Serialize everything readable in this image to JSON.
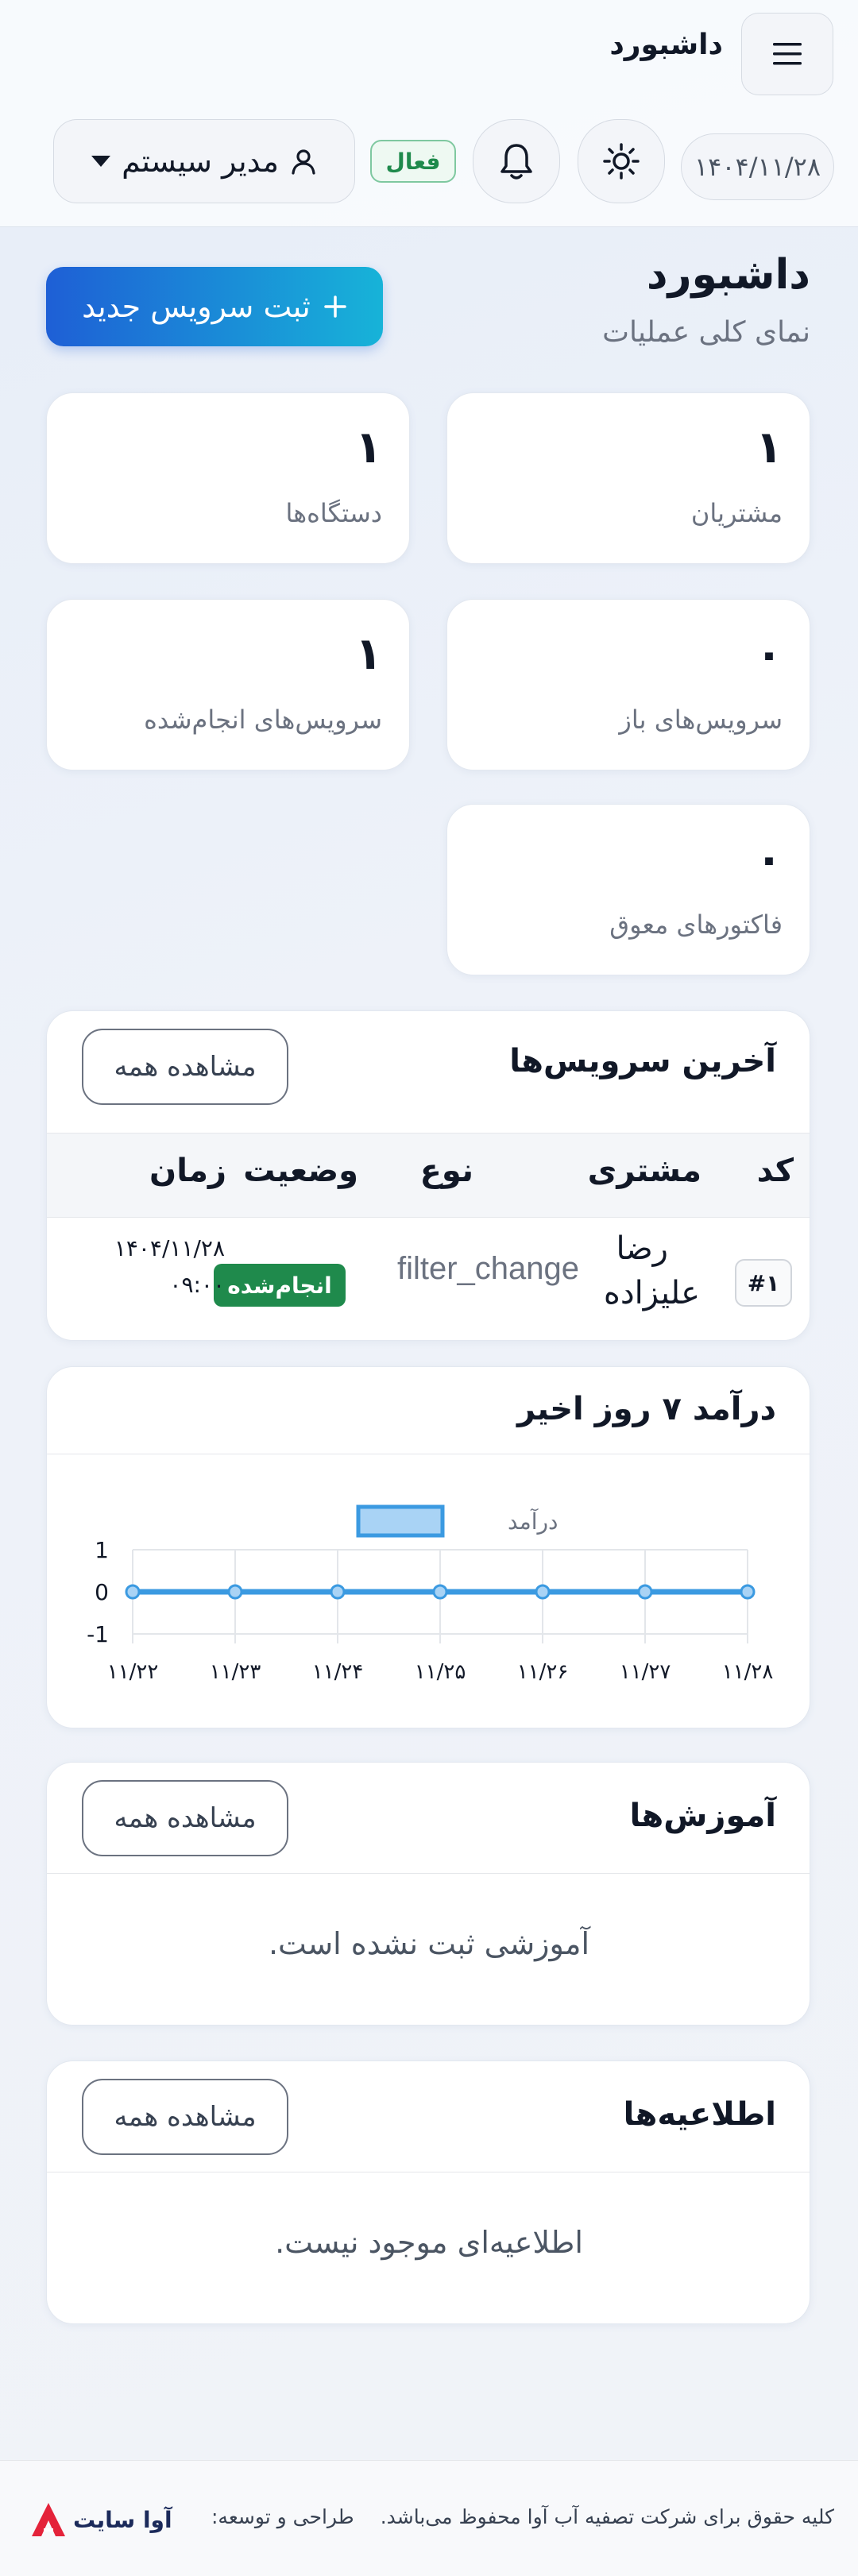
{
  "header": {
    "app_title": "داشبورد",
    "date": "۱۴۰۴/۱۱/۲۸",
    "status_badge": "فعال",
    "user_name": "مدیر سیستم",
    "icons": [
      "menu-icon",
      "sun-icon",
      "bell-icon",
      "user-icon",
      "caret-down-icon"
    ]
  },
  "page": {
    "title": "داشبورد",
    "subtitle": "نمای کلی عملیات",
    "new_service_button": "ثبت سرویس جدید"
  },
  "stats": [
    {
      "label": "مشتریان",
      "value": "۱"
    },
    {
      "label": "دستگاه‌ها",
      "value": "۱"
    },
    {
      "label": "سرویس‌های باز",
      "value": "۰"
    },
    {
      "label": "سرویس‌های انجام‌شده",
      "value": "۱"
    },
    {
      "label": "فاکتورهای معوق",
      "value": "۰"
    }
  ],
  "recent_services": {
    "title": "آخرین سرویس‌ها",
    "view_all": "مشاهده همه",
    "columns": [
      "کد",
      "مشتری",
      "نوع",
      "وضعیت",
      "زمان"
    ],
    "rows": [
      {
        "id": "#۱",
        "customer_line1": "رضا",
        "customer_line2": "علیزاده",
        "type": "filter_change",
        "status": "انجام‌شده",
        "date": "۱۴۰۴/۱۱/۲۸",
        "time": "۰۹:۰۰"
      }
    ]
  },
  "revenue": {
    "title": "درآمد ۷ روز اخیر"
  },
  "chart_data": {
    "type": "line",
    "categories": [
      "۱۱/۲۲",
      "۱۱/۲۳",
      "۱۱/۲۴",
      "۱۱/۲۵",
      "۱۱/۲۶",
      "۱۱/۲۷",
      "۱۱/۲۸"
    ],
    "series": [
      {
        "name": "درآمد",
        "values": [
          0,
          0,
          0,
          0,
          0,
          0,
          0
        ]
      }
    ],
    "ylim": [
      -1,
      1
    ],
    "yticks": [
      "1",
      "0",
      "-1"
    ],
    "grid": true,
    "legend": "top-center",
    "colors": {
      "line": "#3b9ae1",
      "fill": "#a9d3f5"
    }
  },
  "trainings": {
    "title": "آموزش‌ها",
    "view_all": "مشاهده همه",
    "empty": "آموزشی ثبت نشده است."
  },
  "announcements": {
    "title": "اطلاعیه‌ها",
    "view_all": "مشاهده همه",
    "empty": "اطلاعیه‌ای موجود نیست."
  },
  "footer": {
    "copyright": "کلیه حقوق برای شرکت تصفیه آب آوا محفوظ می‌باشد.",
    "design_label": "طراحی و توسعه:",
    "logo_text": "آوا سایت"
  }
}
